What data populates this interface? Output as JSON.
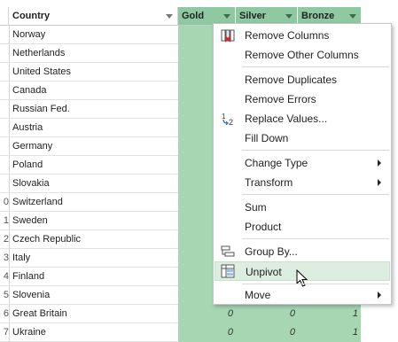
{
  "columns": {
    "country": "Country",
    "gold": "Gold",
    "silver": "Silver",
    "bronze": "Bronze"
  },
  "rows": [
    {
      "idx": "",
      "country": "Norway",
      "gold": "",
      "silver": "",
      "bronze": ""
    },
    {
      "idx": "",
      "country": "Netherlands",
      "gold": "",
      "silver": "",
      "bronze": ""
    },
    {
      "idx": "",
      "country": "United States",
      "gold": "",
      "silver": "",
      "bronze": ""
    },
    {
      "idx": "",
      "country": "Canada",
      "gold": "",
      "silver": "",
      "bronze": ""
    },
    {
      "idx": "",
      "country": "Russian Fed.",
      "gold": "",
      "silver": "",
      "bronze": ""
    },
    {
      "idx": "",
      "country": "Austria",
      "gold": "",
      "silver": "",
      "bronze": ""
    },
    {
      "idx": "",
      "country": "Germany",
      "gold": "",
      "silver": "",
      "bronze": ""
    },
    {
      "idx": "",
      "country": "Poland",
      "gold": "",
      "silver": "",
      "bronze": ""
    },
    {
      "idx": "",
      "country": "Slovakia",
      "gold": "",
      "silver": "",
      "bronze": ""
    },
    {
      "idx": "0",
      "country": "Switzerland",
      "gold": "",
      "silver": "",
      "bronze": ""
    },
    {
      "idx": "1",
      "country": "Sweden",
      "gold": "",
      "silver": "",
      "bronze": ""
    },
    {
      "idx": "2",
      "country": "Czech Republic",
      "gold": "",
      "silver": "",
      "bronze": ""
    },
    {
      "idx": "3",
      "country": "Italy",
      "gold": "",
      "silver": "",
      "bronze": ""
    },
    {
      "idx": "4",
      "country": "Finland",
      "gold": "",
      "silver": "",
      "bronze": ""
    },
    {
      "idx": "5",
      "country": "Slovenia",
      "gold": "",
      "silver": "",
      "bronze": ""
    },
    {
      "idx": "6",
      "country": "Great Britain",
      "gold": "0",
      "silver": "0",
      "bronze": "1"
    },
    {
      "idx": "7",
      "country": "Ukraine",
      "gold": "0",
      "silver": "0",
      "bronze": "1"
    }
  ],
  "menu": {
    "remove_columns": "Remove Columns",
    "remove_other_columns": "Remove Other Columns",
    "remove_duplicates": "Remove Duplicates",
    "remove_errors": "Remove Errors",
    "replace_values": "Replace Values...",
    "fill_down": "Fill Down",
    "change_type": "Change Type",
    "transform": "Transform",
    "sum": "Sum",
    "product": "Product",
    "group_by": "Group By...",
    "unpivot": "Unpivot",
    "move": "Move",
    "replace_icon_text": "1⅓2"
  },
  "icons": {
    "remove_columns": "remove-columns-icon",
    "replace_values": "replace-values-icon",
    "group_by": "group-by-icon",
    "unpivot": "unpivot-icon",
    "cursor": "mouse-pointer-icon"
  },
  "colors": {
    "selected_header": "#8fc9a1",
    "selected_cell": "#a7d6b3",
    "menu_highlight": "#dbeedf"
  }
}
